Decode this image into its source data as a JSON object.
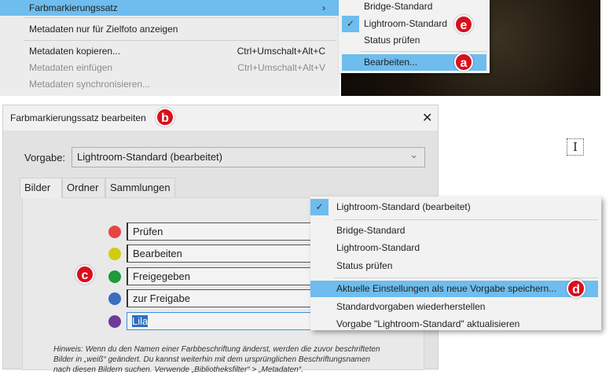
{
  "context_menu": {
    "items": [
      {
        "label": "Farbmarkierungssatz",
        "submenu": true,
        "highlighted": true
      },
      {
        "label": "Metadaten nur für Zielfoto anzeigen"
      },
      {
        "label": "Metadaten kopieren...",
        "shortcut": "Ctrl+Umschalt+Alt+C"
      },
      {
        "label": "Metadaten einfügen",
        "shortcut": "Ctrl+Umschalt+Alt+V",
        "disabled": true
      },
      {
        "label": "Metadaten synchronisieren...",
        "disabled": true
      }
    ],
    "submenu_arrow": "›"
  },
  "submenu": {
    "items": [
      {
        "label": "Bridge-Standard"
      },
      {
        "label": "Lightroom-Standard",
        "checked": true
      },
      {
        "label": "Status prüfen"
      },
      {
        "label": "Bearbeiten...",
        "highlighted": true
      }
    ]
  },
  "badges": {
    "a": "a",
    "b": "b",
    "c": "c",
    "d": "d",
    "e": "e"
  },
  "dialog": {
    "title": "Farbmarkierungssatz bearbeiten",
    "close": "✕",
    "preset_label": "Vorgabe:",
    "preset_value": "Lightroom-Standard (bearbeitet)",
    "tabs": [
      {
        "label": "Bilder",
        "active": true
      },
      {
        "label": "Ordner"
      },
      {
        "label": "Sammlungen"
      }
    ],
    "labels": [
      {
        "color": "#e84545",
        "value": "Prüfen"
      },
      {
        "color": "#d2cc10",
        "value": "Bearbeiten"
      },
      {
        "color": "#1e9a3a",
        "value": "Freigegeben"
      },
      {
        "color": "#3a6cc0",
        "value": "zur Freigabe"
      },
      {
        "color": "#6e3a9a",
        "value": "Lila",
        "selected": true
      }
    ],
    "note": [
      "Hinweis: Wenn du den Namen einer Farbbeschriftung änderst, werden die zuvor beschrifteten",
      "Bilder in „weiß“ geändert. Du kannst weiterhin mit dem ursprünglichen Beschriftungsnamen",
      "nach diesen Bildern suchen. Verwende „Bibliotheksfilter“ > „Metadaten“."
    ]
  },
  "preset_dropdown": {
    "items": [
      {
        "label": "Lightroom-Standard (bearbeitet)",
        "checked": true
      },
      {
        "label": "Bridge-Standard"
      },
      {
        "label": "Lightroom-Standard"
      },
      {
        "label": "Status prüfen"
      },
      {
        "label": "Aktuelle Einstellungen als neue Vorgabe speichern...",
        "highlighted": true
      },
      {
        "label": "Standardvorgaben wiederherstellen"
      },
      {
        "label": "Vorgabe \"Lightroom-Standard\" aktualisieren"
      }
    ]
  },
  "icons": {
    "check": "✓",
    "chevron": "⌄"
  },
  "colors": {
    "highlight": "#6ebdee",
    "badge": "#d8101e"
  }
}
